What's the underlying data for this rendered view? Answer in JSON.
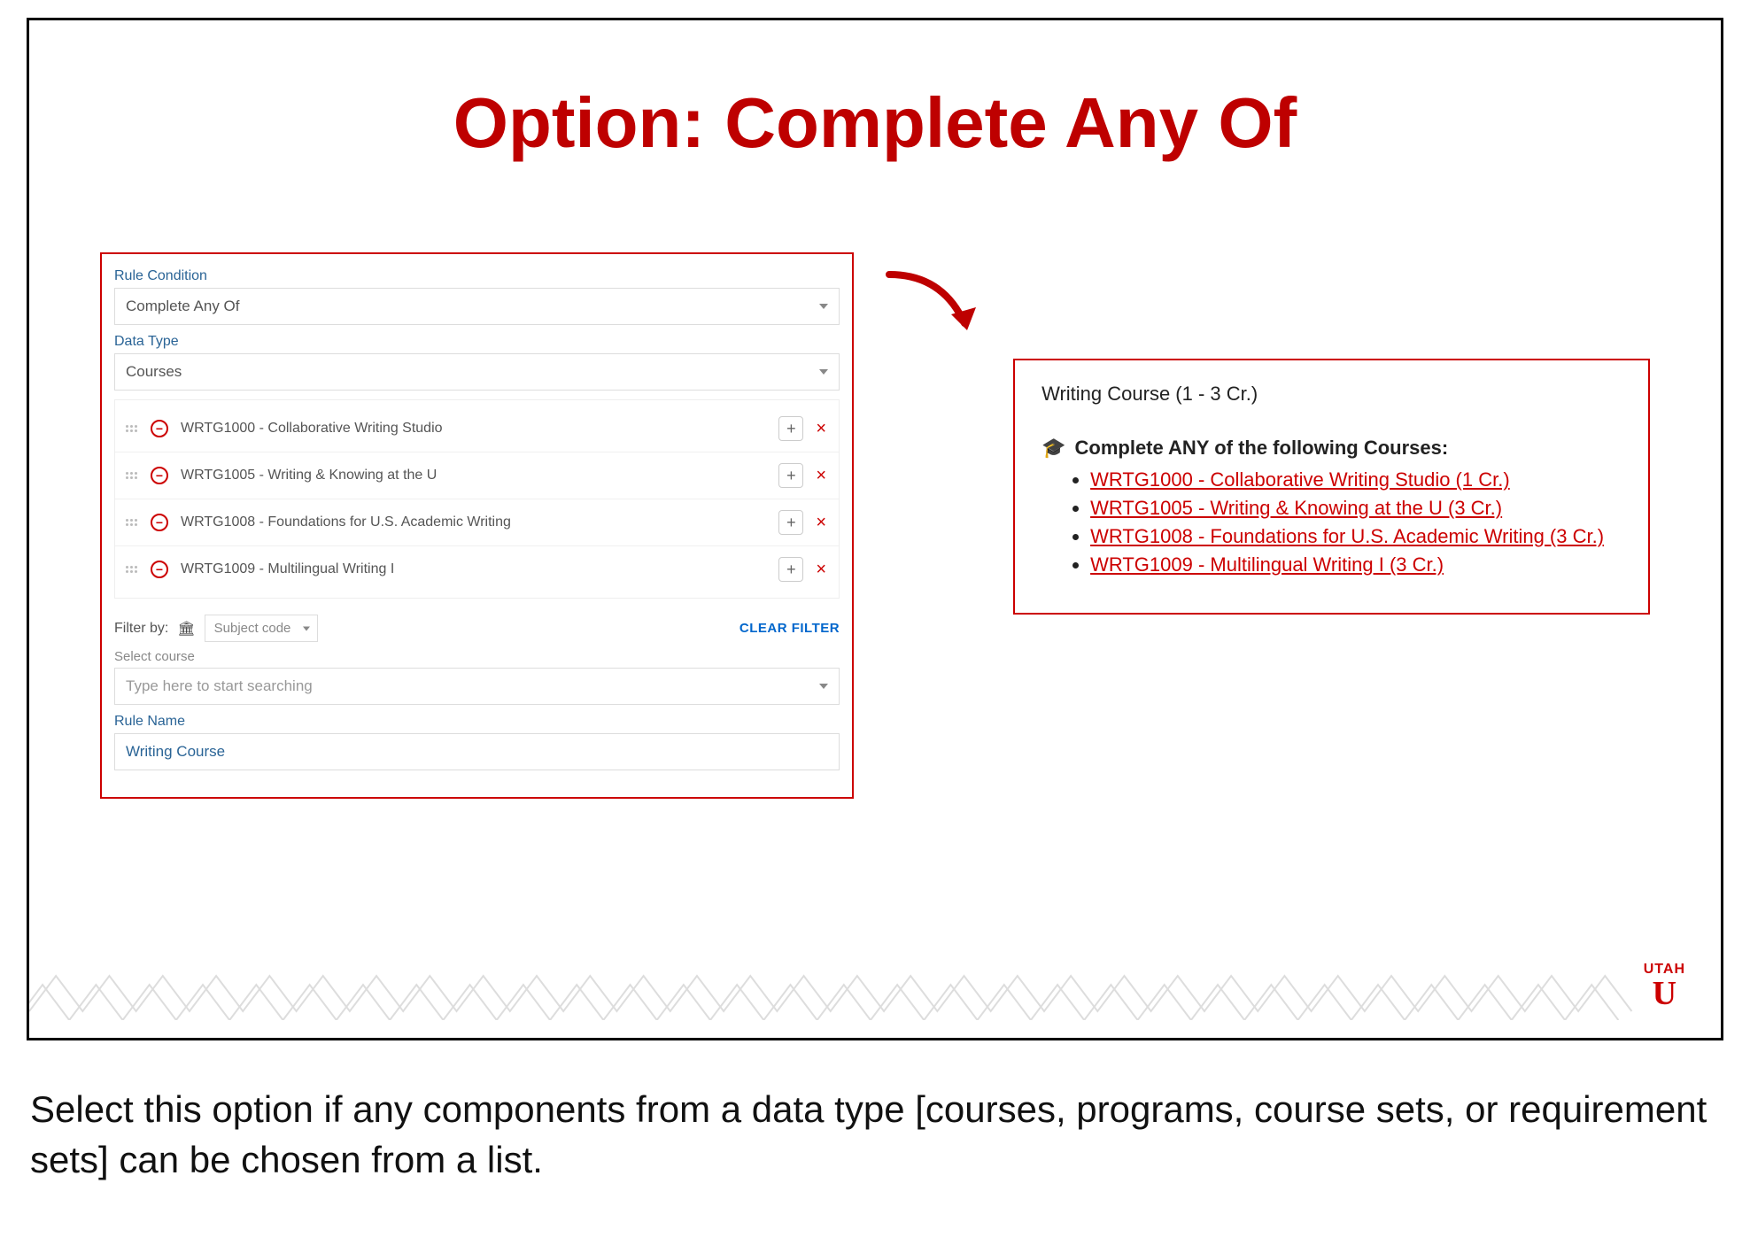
{
  "title": "Option: Complete Any Of",
  "left": {
    "rule_condition_label": "Rule Condition",
    "rule_condition_value": "Complete Any Of",
    "data_type_label": "Data Type",
    "data_type_value": "Courses",
    "courses": [
      "WRTG1000 - Collaborative Writing Studio",
      "WRTG1005 - Writing & Knowing at the U",
      "WRTG1008 - Foundations for U.S. Academic Writing",
      "WRTG1009 - Multilingual Writing I"
    ],
    "filter_by_label": "Filter by:",
    "subject_code_placeholder": "Subject code",
    "clear_filter": "CLEAR FILTER",
    "select_course_label": "Select course",
    "search_placeholder": "Type here to start searching",
    "rule_name_label": "Rule Name",
    "rule_name_value": "Writing Course"
  },
  "right": {
    "header": "Writing Course (1 - 3 Cr.)",
    "complete_label": "Complete ANY of the following Courses:",
    "links": [
      "WRTG1000 - Collaborative Writing Studio (1 Cr.)",
      "WRTG1005 - Writing & Knowing at the U (3 Cr.)",
      "WRTG1008 - Foundations for U.S. Academic Writing (3 Cr.)",
      "WRTG1009 - Multilingual Writing I (3 Cr.)"
    ]
  },
  "logo": {
    "text": "UTAH",
    "letter": "U"
  },
  "instruction": "Select this option if any components from a data type [courses, programs, course sets, or requirement sets] can be chosen from a list."
}
